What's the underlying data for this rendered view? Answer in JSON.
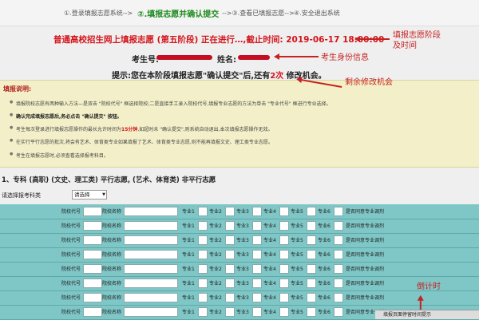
{
  "steps": {
    "s1": "①.登录填报志愿系统-->",
    "s2": "②.填报志愿并确认提交",
    "s3": "-->③.查看已填报志愿-->",
    "s4": "④.安全退出系统"
  },
  "header": {
    "title": "普通高校招生网上填报志愿 (第五阶段) 正在进行…,截止时间: 2019-06-17 18:00:00",
    "exam_label": "考生号:",
    "name_label": "姓名:",
    "tip_before": "提示:您在本阶段填报志愿\"确认提交\"后,还有",
    "tip_count": "2次",
    "tip_after": " 修改机会。"
  },
  "notes": {
    "title": "填报说明:",
    "items": [
      "填报院校志愿有两种输入方法—是双击 \"院校代号\" 框选择院校;二是直接手工录入院校代号,填报专业志愿的方法为单击 \"专业代号\" 框进行专业选择。",
      "确认完成填报志愿后,务必点击 \"确认提交\" 按钮。",
      "考生每次登录进行填报志愿操作的最长允许时间为",
      "在实行平行志愿的批次,将会有艺术、体育类专业如果填报了艺术、体育类专业志愿,则不能再填报文史、理工类专业志愿。",
      "考生在填报志愿时,必须查看选择报考科目。"
    ],
    "item3_time": "15分钟",
    "item3_after": ",如超时未 \"确认提交\",则系统自动退出,本次填报志愿操作无效。"
  },
  "section": {
    "heading": "1、专科 (高职) (文史、理工类) 平行志愿, (艺术、体育类) 非平行志愿",
    "select_label": "请选择报考科类",
    "select_value": "请选择"
  },
  "grid": {
    "code_label": "院校代号",
    "name_label": "院校名称",
    "major1": "专业1",
    "major2": "专业2",
    "major3": "专业3",
    "major4": "专业4",
    "major5": "专业5",
    "major6": "专业6",
    "adjust_label": "是否同意专业调剂"
  },
  "annotations": {
    "stage": "填报志愿阶段\n及时间",
    "identity": "考生身份信息",
    "chances": "剩余修改机会",
    "countdown": "倒计时"
  },
  "footer": {
    "tip": "填报页面停留时间提示"
  },
  "colors": {
    "accent_red": "#d4141b",
    "active_step_green": "#1e8a1e",
    "grid_teal": "#7fc6c6",
    "note_bg": "#f3f0c9"
  }
}
